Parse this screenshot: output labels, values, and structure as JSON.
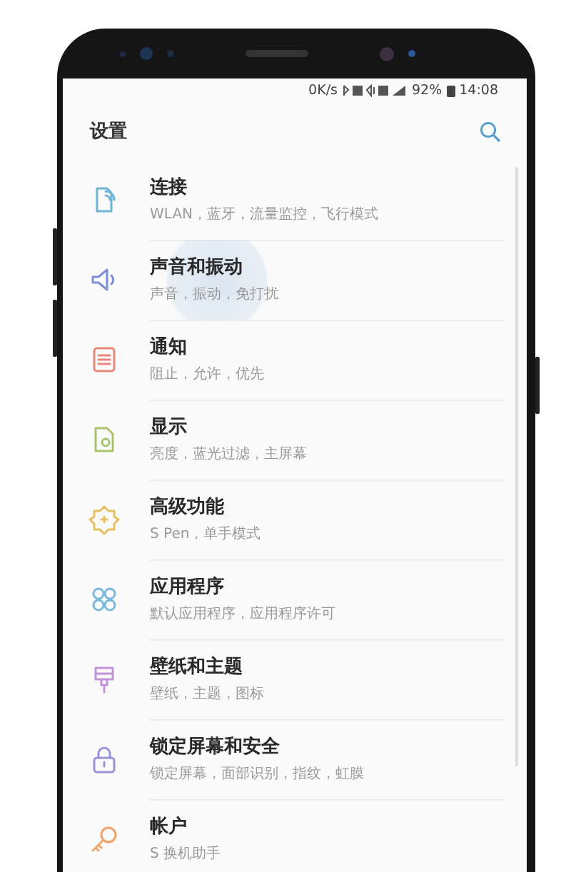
{
  "status_bar": {
    "speed": "0K/s",
    "battery": "92%",
    "time": "14:08"
  },
  "header": {
    "title": "设置"
  },
  "items": [
    {
      "title": "连接",
      "subtitle": "WLAN，蓝牙，流量监控，飞行模式",
      "color": "#6fb3d6",
      "pressed": false
    },
    {
      "title": "声音和振动",
      "subtitle": "声音，振动，免打扰",
      "color": "#7e8fd8",
      "pressed": true
    },
    {
      "title": "通知",
      "subtitle": "阻止，允许，优先",
      "color": "#e9877a",
      "pressed": false
    },
    {
      "title": "显示",
      "subtitle": "亮度，蓝光过滤，主屏幕",
      "color": "#a9c36b",
      "pressed": false
    },
    {
      "title": "高级功能",
      "subtitle": "S Pen，单手模式",
      "color": "#e6bf5e",
      "pressed": false
    },
    {
      "title": "应用程序",
      "subtitle": "默认应用程序，应用程序许可",
      "color": "#78b9dc",
      "pressed": false
    },
    {
      "title": "壁纸和主题",
      "subtitle": "壁纸，主题，图标",
      "color": "#c293d6",
      "pressed": false
    },
    {
      "title": "锁定屏幕和安全",
      "subtitle": "锁定屏幕，面部识别，指纹，虹膜",
      "color": "#9a93d8",
      "pressed": false
    },
    {
      "title": "帐户",
      "subtitle": "S 换机助手",
      "color": "#eda36a",
      "pressed": false
    }
  ]
}
